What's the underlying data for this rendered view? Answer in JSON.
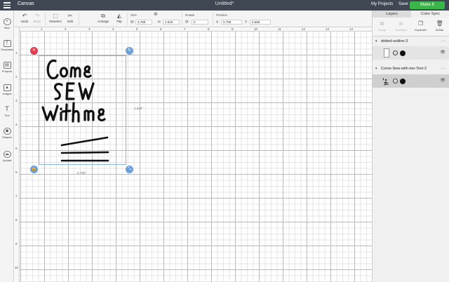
{
  "topbar": {
    "app_name": "Canvas",
    "document_title": "Untitled*",
    "my_projects": "My Projects",
    "save": "Save",
    "make_it": "Make It"
  },
  "toolbar": {
    "undo": "Undo",
    "redo": "Redo",
    "deselect": "Deselect",
    "edit": "Edit",
    "arrange": "Arrange",
    "flip": "Flip",
    "size_label": "Size",
    "w_label": "W",
    "w_value": "3.789",
    "h_label": "H",
    "h_value": "4.819",
    "rotate_label": "Rotate",
    "rotate_value": "0",
    "position_label": "Position",
    "x_label": "X",
    "x_value": "0.708",
    "y_label": "Y",
    "y_value": "0.658"
  },
  "sidebar": {
    "items": [
      {
        "label": "New",
        "icon": "plus-icon"
      },
      {
        "label": "Templates",
        "icon": "shirt-icon"
      },
      {
        "label": "Projects",
        "icon": "projects-icon"
      },
      {
        "label": "Images",
        "icon": "image-icon"
      },
      {
        "label": "Text",
        "icon": "text-icon"
      },
      {
        "label": "Shapes",
        "icon": "shapes-icon"
      },
      {
        "label": "Upload",
        "icon": "cloud-upload-icon"
      }
    ]
  },
  "canvas": {
    "ruler_top": [
      "1",
      "2",
      "3",
      "4",
      "5",
      "6",
      "7",
      "8",
      "9",
      "10",
      "11",
      "12",
      "13",
      "14"
    ],
    "ruler_left": [
      "1",
      "2",
      "3",
      "4",
      "5",
      "6",
      "7",
      "8",
      "9",
      "10"
    ],
    "width_dimension": "3.789\"",
    "height_dimension": "4.819\""
  },
  "panel": {
    "tab_layers": "Layers",
    "tab_color_sync": "Color Sync",
    "actions": {
      "group": "Group",
      "ungroup": "UnGroup",
      "duplicate": "Duplicate",
      "delete": "Delete"
    },
    "layers": [
      {
        "name": "dotted-outline-3"
      },
      {
        "name": "Come-Sew-with-me-Text-2"
      }
    ]
  },
  "colors": {
    "topbar": "#3f4852",
    "make_it": "#3bb54a",
    "delete_handle": "#e23d4f",
    "handle": "#6c9fd6"
  }
}
